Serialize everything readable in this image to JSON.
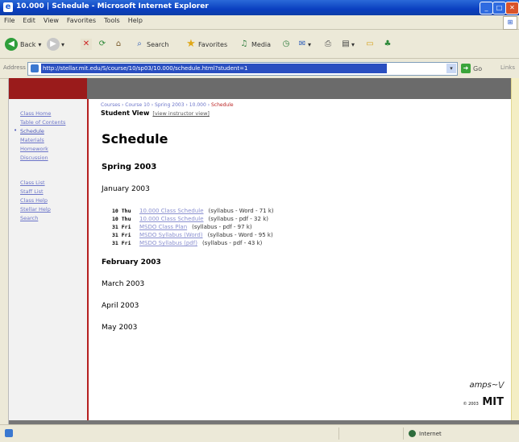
{
  "window": {
    "title": "10.000 | Schedule - Microsoft Internet Explorer",
    "minimize": "_",
    "maximize": "□",
    "close": "✕"
  },
  "menu": [
    "File",
    "Edit",
    "View",
    "Favorites",
    "Tools",
    "Help"
  ],
  "toolbar": {
    "back": "Back",
    "search": "Search",
    "favorites": "Favorites",
    "media": "Media"
  },
  "address": {
    "label": "Address",
    "url": "http://stellar.mit.edu/S/course/10/sp03/10.000/schedule.html?student=1",
    "go": "Go",
    "links": "Links"
  },
  "sidebar": {
    "items": [
      {
        "label": "Class Home"
      },
      {
        "label": "Table of Contents"
      },
      {
        "label": "Schedule",
        "current": true
      },
      {
        "label": "Materials"
      },
      {
        "label": "Homework"
      },
      {
        "label": "Discussion"
      },
      {
        "label": "Class List"
      },
      {
        "label": "Staff List"
      },
      {
        "label": "Class Help"
      },
      {
        "label": "Stellar Help"
      },
      {
        "label": "Search"
      }
    ]
  },
  "content": {
    "breadcrumb": [
      "Courses",
      "Course 10",
      "Spring 2003",
      "10.000"
    ],
    "breadcrumb_current": "Schedule",
    "view_label": "Student View",
    "view_link": "[view instructor view]",
    "page_title": "Schedule",
    "term": "Spring 2003",
    "months": [
      "January 2003",
      "February 2003",
      "March 2003",
      "April 2003",
      "May 2003"
    ],
    "entries": [
      {
        "day": "10 Thu",
        "link": "10.000 Class Schedule",
        "file": "(syllabus - Word - 71 k)"
      },
      {
        "day": "10 Thu",
        "link": "10.000 Class Schedule",
        "file": "(syllabus - pdf - 32 k)"
      },
      {
        "day": "31 Fri",
        "link": "MSDO Class Plan",
        "file": "(syllabus - pdf - 97 k)"
      },
      {
        "day": "31 Fri",
        "link": "MSDO Syllabus (Word)",
        "file": "(syllabus - Word - 95 k)"
      },
      {
        "day": "31 Fri",
        "link": "MSDO Syllabus (pdf)",
        "file": "(syllabus - pdf - 43 k)"
      }
    ]
  },
  "footer": {
    "amps": "amps",
    "amps_mark": "~\\/",
    "mit_prefix": "© 2003",
    "mit_logo": "MIT"
  },
  "status": {
    "zone": "Internet"
  },
  "colors": {
    "titlebar": "#0a3fc0",
    "accent_red": "#9a1b1b",
    "link": "#6b74c8"
  }
}
